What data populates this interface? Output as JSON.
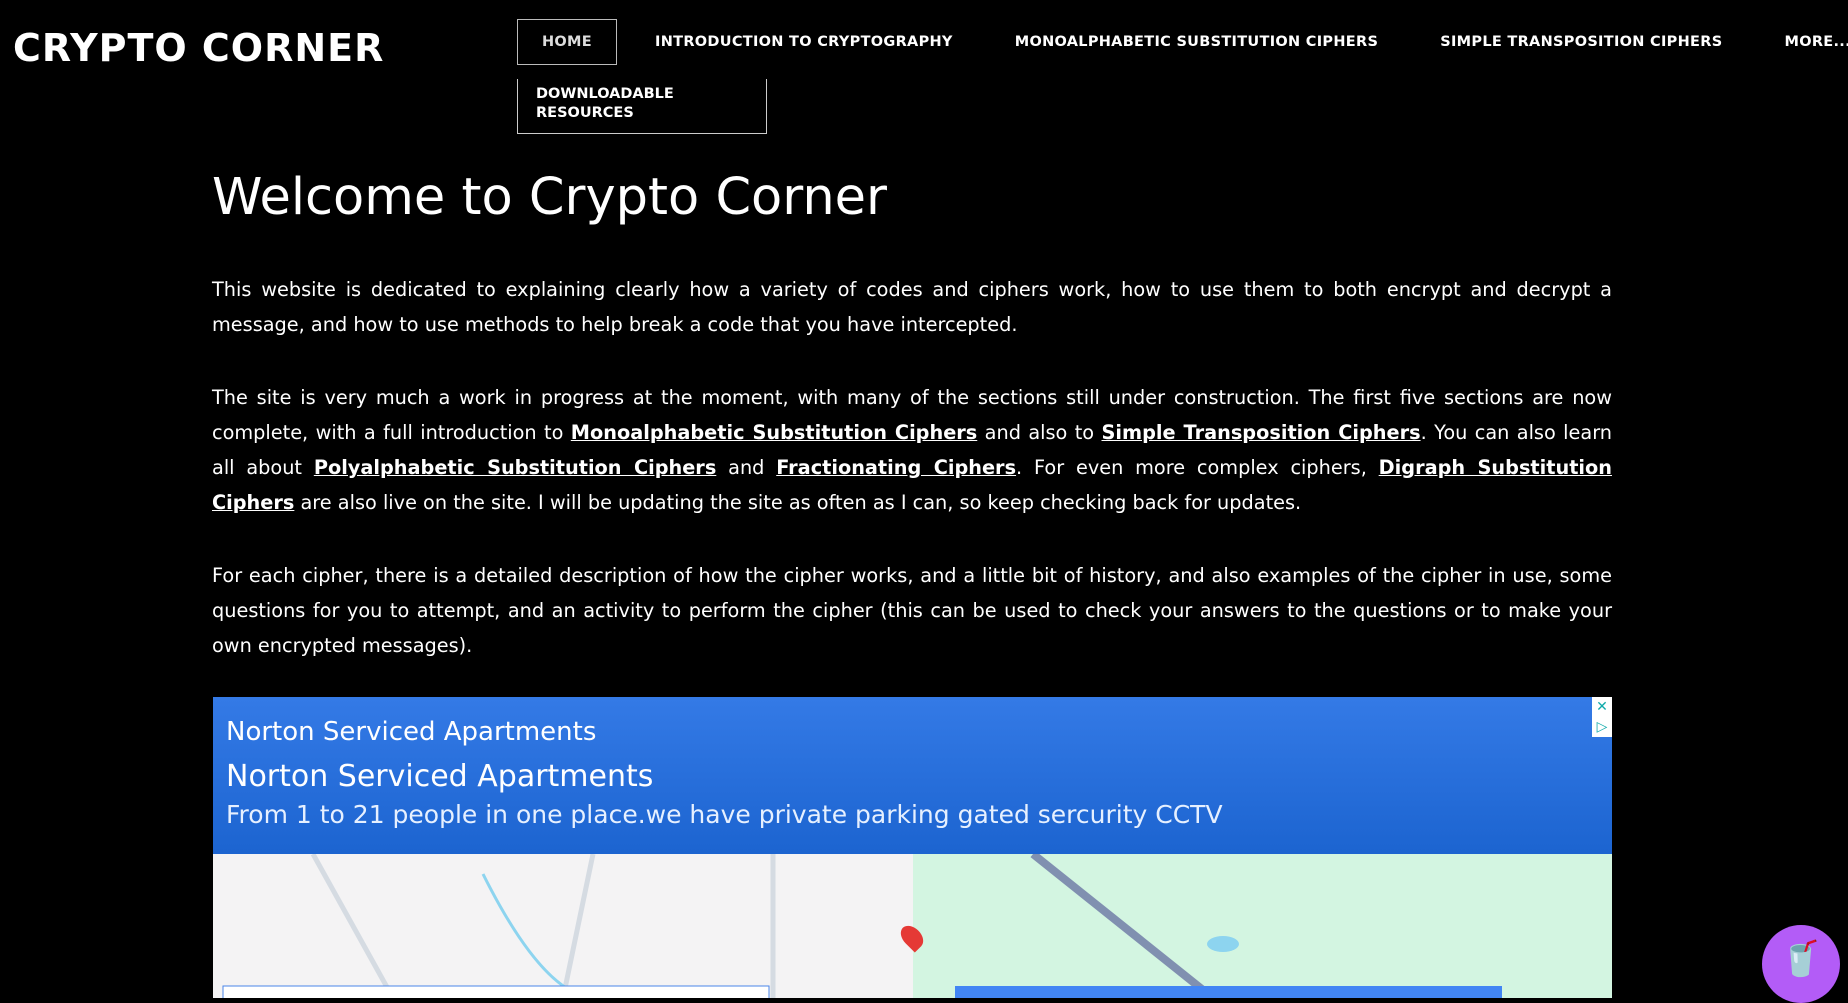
{
  "logo": "CRYPTO CORNER",
  "nav": {
    "home": "HOME",
    "intro": "INTRODUCTION TO CRYPTOGRAPHY",
    "mono": "MONOALPHABETIC SUBSTITUTION CIPHERS",
    "simple": "SIMPLE TRANSPOSITION CIPHERS",
    "more": "MORE...",
    "dropdown": "DOWNLOADABLE RESOURCES"
  },
  "title": "Welcome to Crypto Corner",
  "p1": "This website is dedicated to explaining clearly how a variety of codes and ciphers work, how to use them to both encrypt and decrypt a message, and how to use methods to help break a code that you have intercepted.",
  "p2": {
    "a": "The site is very much a work in progress at the moment, with many of the sections still under construction. The first five sections are now complete, with a full introduction to ",
    "l1": "Monoalphabetic Substitution Ciphers",
    "b": " and also to ",
    "l2": "Simple Transposition Ciphers",
    "c": ". You can also learn all about ",
    "l3": "Polyalphabetic Substitution Ciphers",
    "d": " and ",
    "l4": "Fractionating Ciphers",
    "e": ". For even more complex ciphers, ",
    "l5": "Digraph Substitution Ciphers",
    "f": " are also live on the site. I will be updating the site as often as I can, so keep checking back for updates."
  },
  "p3": "For each cipher, there is a detailed description of how the cipher works, and a little bit of history, and also examples of the cipher in use, some questions for you to attempt, and an activity to perform the cipher (this can be used to check your answers to the questions or to make your own encrypted messages).",
  "ad": {
    "line1": "Norton Serviced Apartments",
    "line2": "Norton Serviced Apartments",
    "line3": "From 1 to 21 people in one place.we have private parking gated sercurity CCTV",
    "close": "✕",
    "info": "▷"
  },
  "cup_icon": "🥤"
}
